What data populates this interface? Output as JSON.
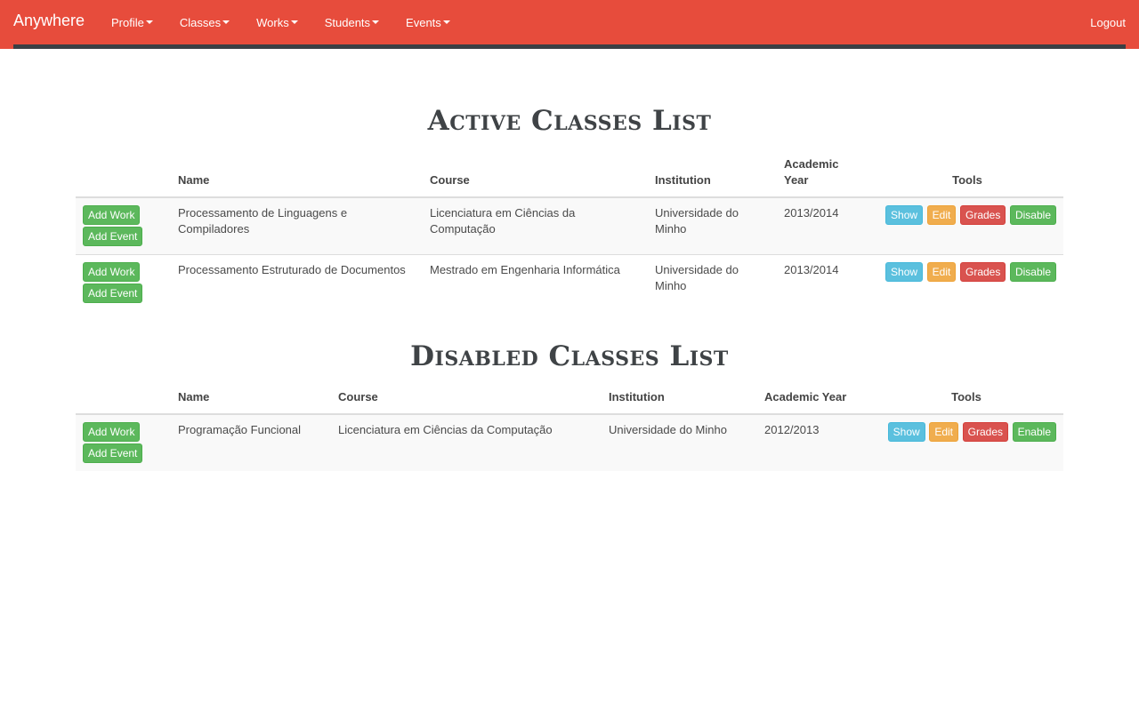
{
  "navbar": {
    "brand": "Anywhere",
    "items": [
      "Profile",
      "Classes",
      "Works",
      "Students",
      "Events"
    ],
    "logout": "Logout",
    "color": "#e74c3c"
  },
  "active": {
    "title": "Active Classes List",
    "headers": {
      "name": "Name",
      "course": "Course",
      "institution": "Institution",
      "year": "Academic Year",
      "tools": "Tools"
    },
    "rows": [
      {
        "add_work": "Add Work",
        "add_event": "Add Event",
        "name": "Processamento de Linguagens e Compiladores",
        "course": "Licenciatura em Ciências da Computação",
        "institution": "Universidade do Minho",
        "year": "2013/2014",
        "show": "Show",
        "edit": "Edit",
        "grades": "Grades",
        "toggle": "Disable"
      },
      {
        "add_work": "Add Work",
        "add_event": "Add Event",
        "name": "Processamento Estruturado de Documentos",
        "course": "Mestrado em Engenharia Informática",
        "institution": "Universidade do Minho",
        "year": "2013/2014",
        "show": "Show",
        "edit": "Edit",
        "grades": "Grades",
        "toggle": "Disable"
      }
    ]
  },
  "disabled": {
    "title": "Disabled Classes List",
    "headers": {
      "name": "Name",
      "course": "Course",
      "institution": "Institution",
      "year": "Academic Year",
      "tools": "Tools"
    },
    "rows": [
      {
        "add_work": "Add Work",
        "add_event": "Add Event",
        "name": "Programação Funcional",
        "course": "Licenciatura em Ciências da Computação",
        "institution": "Universidade do Minho",
        "year": "2012/2013",
        "show": "Show",
        "edit": "Edit",
        "grades": "Grades",
        "toggle": "Enable"
      }
    ]
  }
}
